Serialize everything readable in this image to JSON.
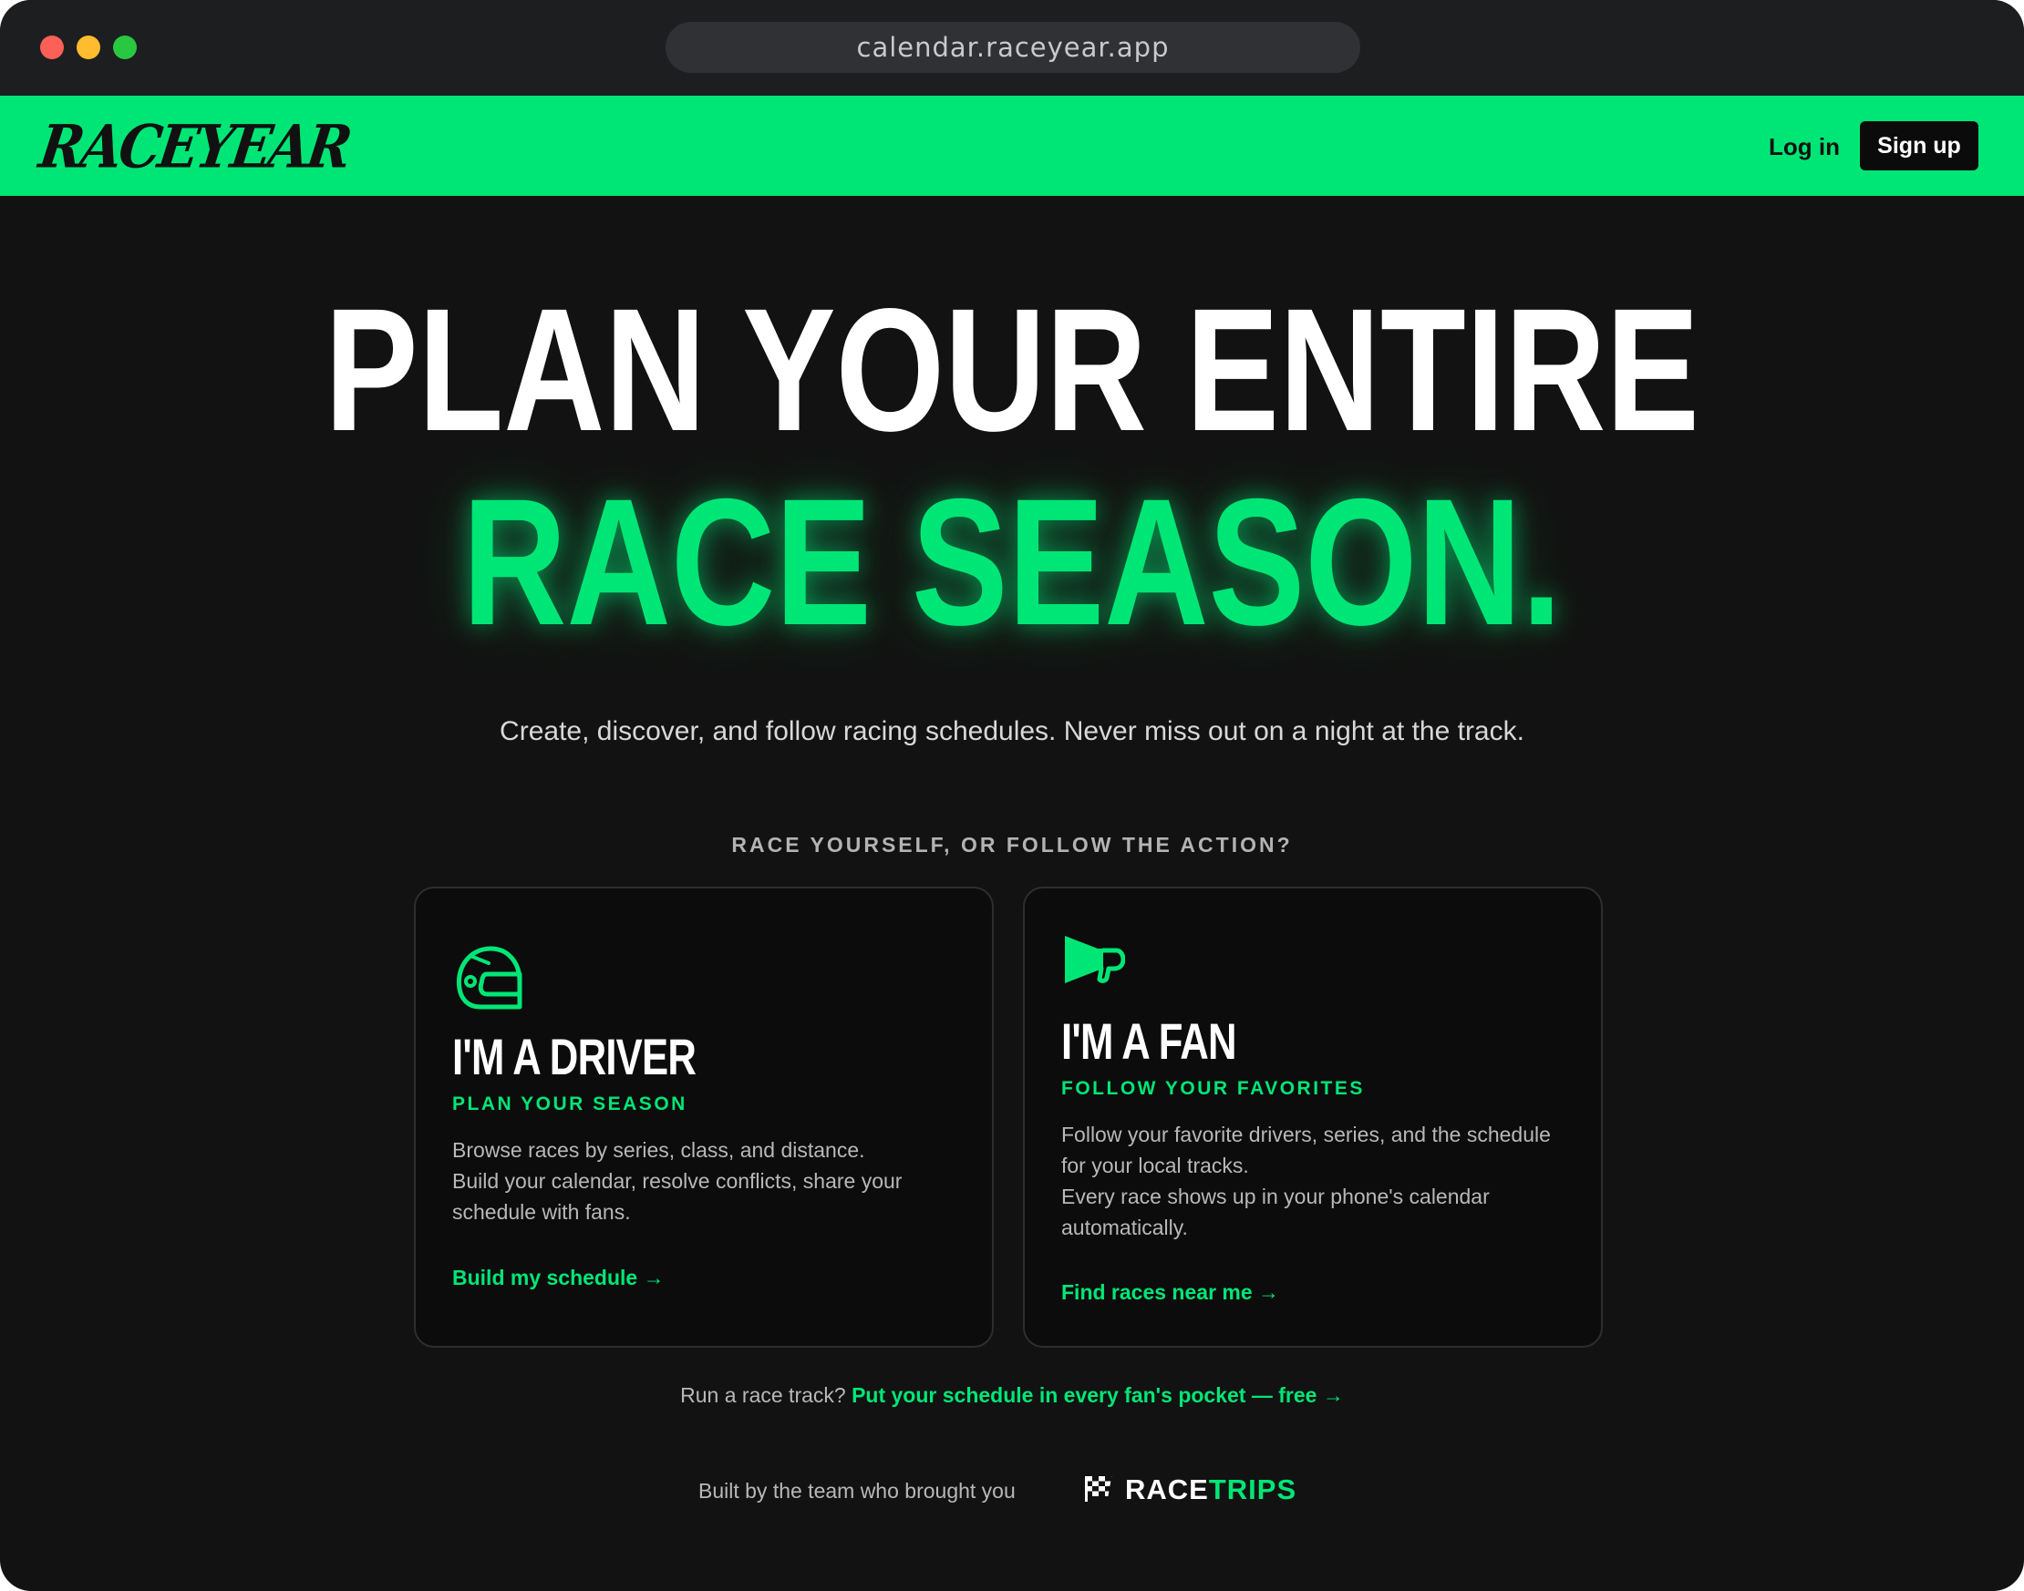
{
  "browser": {
    "url": "calendar.raceyear.app"
  },
  "nav": {
    "logo": "RACEYEAR",
    "login": "Log in",
    "signup": "Sign up"
  },
  "hero": {
    "line1": "PLAN YOUR ENTIRE",
    "line2": "RACE SEASON.",
    "subtitle": "Create, discover, and follow racing schedules. Never miss out on a night at the track.",
    "question": "RACE YOURSELF, OR FOLLOW THE ACTION?"
  },
  "cards": {
    "driver": {
      "icon": "helmet-icon",
      "title": "I'M A DRIVER",
      "subtitle": "PLAN YOUR SEASON",
      "body": [
        "Browse races by series, class, and distance.",
        "Build your calendar, resolve conflicts, share your schedule with fans."
      ],
      "link": "Build my schedule →"
    },
    "fan": {
      "icon": "megaphone-icon",
      "title": "I'M A FAN",
      "subtitle": "FOLLOW YOUR FAVORITES",
      "body": [
        "Follow your favorite drivers, series, and the schedule for your local tracks.",
        "Every race shows up in your phone's calendar automatically."
      ],
      "link": "Find races near me →"
    }
  },
  "track": {
    "prefix": "Run a race track?",
    "link": "Put your schedule in every fan's pocket — free →"
  },
  "footer": {
    "built_by": "Built by the team who brought you",
    "brand_race": "RACE",
    "brand_trips": "TRIPS",
    "brand_icon": "checkered-flag-icon"
  },
  "colors": {
    "accent": "#00e676",
    "background": "#121212",
    "card": "#0c0c0c"
  }
}
